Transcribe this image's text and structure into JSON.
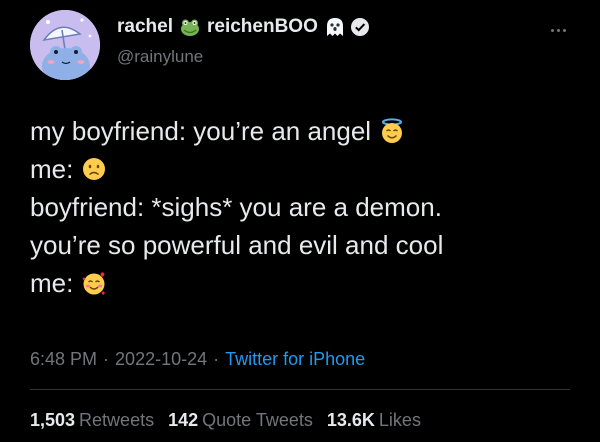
{
  "author": {
    "display_name_part1": "rachel",
    "display_name_part2": "reichenBOO",
    "handle": "@rainylune",
    "icons": [
      "frog-emoji-icon",
      "ghost-emoji-icon",
      "verified-badge-icon"
    ]
  },
  "menu": {
    "icon": "more-options-icon"
  },
  "tweet": {
    "lines": [
      {
        "text": "my boyfriend: you’re an angel",
        "emoji": "smiling-face-with-halo-icon"
      },
      {
        "text": "me:",
        "emoji": "frowning-face-icon"
      },
      {
        "text": "boyfriend: *sighs* you are a demon.",
        "emoji": ""
      },
      {
        "text": "you’re so powerful and evil and cool",
        "emoji": ""
      },
      {
        "text": "me:",
        "emoji": "smiling-face-with-hearts-icon"
      }
    ]
  },
  "meta": {
    "time": "6:48 PM",
    "date": "2022-10-24",
    "separator": "·",
    "source": "Twitter for iPhone"
  },
  "stats": {
    "retweets_count": "1,503",
    "retweets_label": "Retweets",
    "quote_count": "142",
    "quote_label": "Quote Tweets",
    "likes_count": "13.6K",
    "likes_label": "Likes"
  },
  "colors": {
    "background": "#000000",
    "primary_text": "#e7e9ea",
    "secondary_text": "#71767b",
    "link": "#1d9bf0",
    "divider": "#2f3336"
  }
}
